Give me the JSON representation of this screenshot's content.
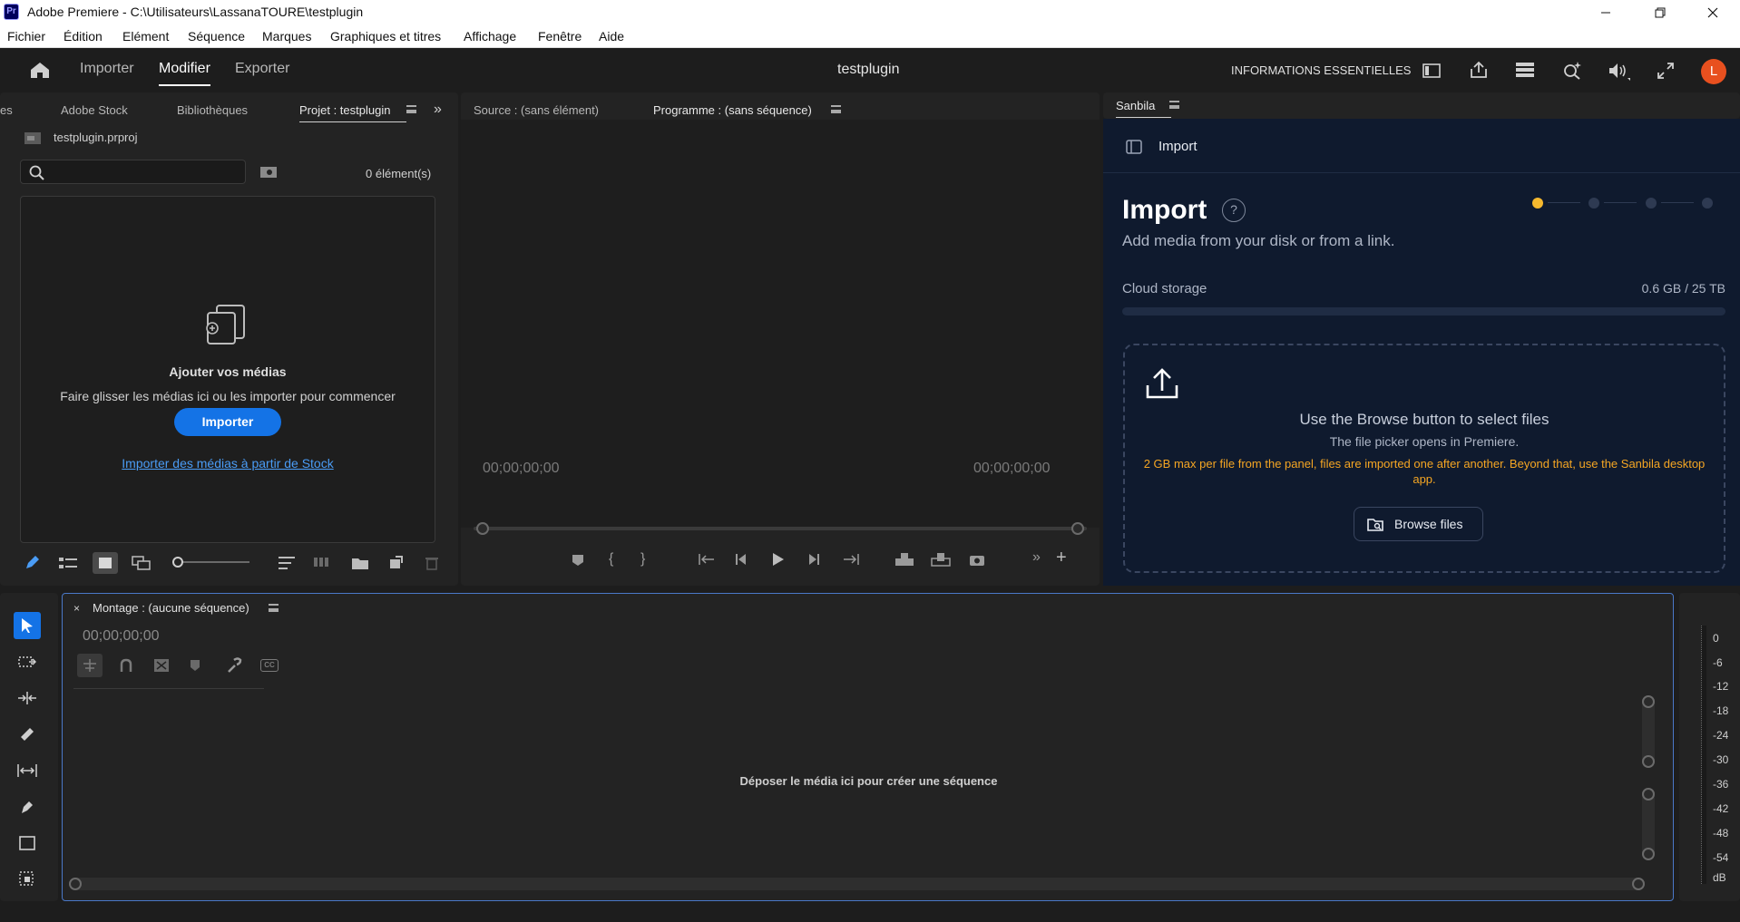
{
  "window": {
    "title": "Adobe Premiere - C:\\Utilisateurs\\LassanaTOURE\\testplugin",
    "app_icon_label": "Pr"
  },
  "menu": [
    "Fichier",
    "Édition",
    "Elément",
    "Séquence",
    "Marques",
    "Graphiques et titres",
    "Affichage",
    "Fenêtre",
    "Aide"
  ],
  "header": {
    "tabs": [
      "Importer",
      "Modifier",
      "Exporter"
    ],
    "active_tab": "Modifier",
    "project_title": "testplugin",
    "workspace_label": "INFORMATIONS ESSENTIELLES",
    "avatar_letter": "L"
  },
  "project_panel": {
    "tabs": [
      "es",
      "Adobe Stock",
      "Bibliothèques",
      "Projet : testplugin"
    ],
    "file_name": "testplugin.prproj",
    "search_placeholder": "",
    "item_count": "0 élément(s)",
    "empty_title": "Ajouter vos médias",
    "empty_subtitle": "Faire glisser les médias ici ou les importer pour commencer",
    "import_button": "Importer",
    "stock_link": "Importer des médias à partir de Stock"
  },
  "monitor_panel": {
    "source_tab": "Source : (sans élément)",
    "program_tab": "Programme : (sans séquence)",
    "timecode_left": "00;00;00;00",
    "timecode_right": "00;00;00;00"
  },
  "sanbila": {
    "tab": "Sanbila",
    "nav_title": "Import",
    "heading": "Import",
    "subheading": "Add media from your disk or from a link.",
    "storage_label": "Cloud storage",
    "storage_value": "0.6 GB / 25 TB",
    "storage_used_fraction": 2.4e-05,
    "steps_total": 4,
    "step_active": 1,
    "drop_title": "Use the Browse button to select files",
    "drop_subtitle": "The file picker opens in Premiere.",
    "drop_warning": "2 GB max per file from the panel, files are imported one after another. Beyond that, use the Sanbila desktop app.",
    "browse_button": "Browse files",
    "accent_color": "#f5b82e",
    "warning_color": "#f5a623"
  },
  "timeline": {
    "tab": "Montage : (aucune séquence)",
    "timecode": "00;00;00;00",
    "drop_hint": "Déposer le média ici pour créer une séquence",
    "meter_labels": [
      "0",
      "-6",
      "-12",
      "-18",
      "-24",
      "-30",
      "-36",
      "-42",
      "-48",
      "-54",
      "dB"
    ]
  },
  "colors": {
    "accent_blue": "#1473e6",
    "avatar": "#e8501f",
    "link": "#4a9cf5"
  }
}
